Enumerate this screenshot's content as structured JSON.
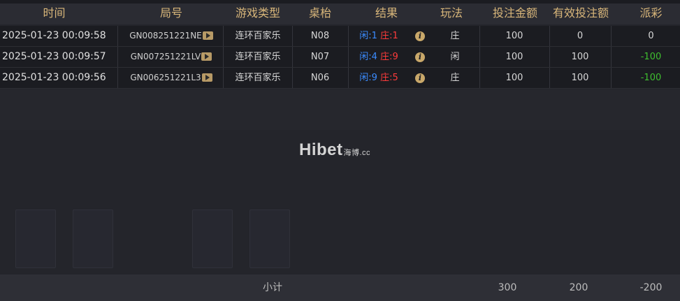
{
  "headers": {
    "time": "时间",
    "round": "局号",
    "game_type": "游戏类型",
    "table": "桌枱",
    "result": "结果",
    "play": "玩法",
    "bet": "投注金额",
    "valid_bet": "有效投注额",
    "payout": "派彩"
  },
  "rows": [
    {
      "time": "2025-01-23 00:09:58",
      "round": "GN008251221NE",
      "game_type": "连环百家乐",
      "table": "N08",
      "player_label": "闲:",
      "player_val": "1",
      "banker_label": "庄:",
      "banker_val": "1",
      "play": "庄",
      "bet": "100",
      "valid_bet": "0",
      "payout": "0"
    },
    {
      "time": "2025-01-23 00:09:57",
      "round": "GN007251221LV",
      "game_type": "连环百家乐",
      "table": "N07",
      "player_label": "闲:",
      "player_val": "4",
      "banker_label": "庄:",
      "banker_val": "9",
      "play": "闲",
      "bet": "100",
      "valid_bet": "100",
      "payout": "-100"
    },
    {
      "time": "2025-01-23 00:09:56",
      "round": "GN006251221L3",
      "game_type": "连环百家乐",
      "table": "N06",
      "player_label": "闲:",
      "player_val": "9",
      "banker_label": "庄:",
      "banker_val": "5",
      "play": "庄",
      "bet": "100",
      "valid_bet": "100",
      "payout": "-100"
    }
  ],
  "watermark": {
    "brand": "Hibet",
    "suffix": "海博.cc"
  },
  "footer": {
    "label": "小计",
    "bet_total": "300",
    "valid_total": "200",
    "payout_total": "-200"
  },
  "colors": {
    "gold": "#d8b67a",
    "player": "#3b8cff",
    "banker": "#ff3b3b",
    "negative": "#3fbf2f"
  },
  "icons": {
    "play": "play-video-icon",
    "info": "info-icon"
  }
}
